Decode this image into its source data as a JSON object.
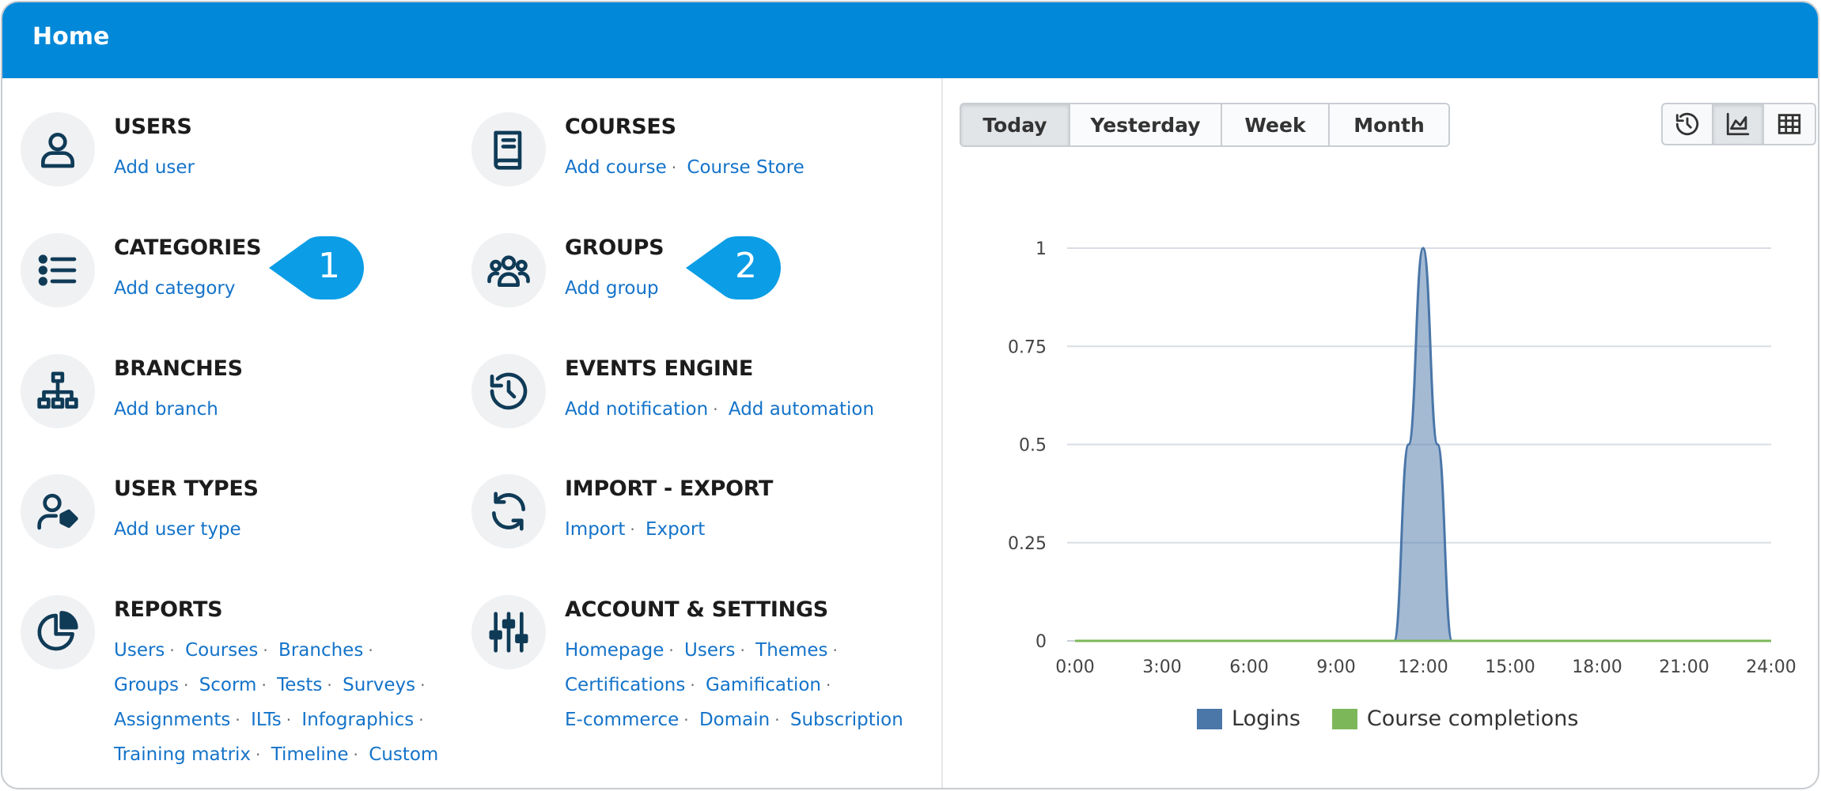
{
  "header": {
    "title": "Home"
  },
  "left_column": [
    {
      "key": "users",
      "title": "USERS",
      "icon": "user-icon",
      "links": [
        "Add user"
      ]
    },
    {
      "key": "categories",
      "title": "CATEGORIES",
      "icon": "list-icon",
      "links": [
        "Add category"
      ]
    },
    {
      "key": "branches",
      "title": "BRANCHES",
      "icon": "sitemap-icon",
      "links": [
        "Add branch"
      ]
    },
    {
      "key": "user-types",
      "title": "USER TYPES",
      "icon": "user-tag-icon",
      "links": [
        "Add user type"
      ]
    },
    {
      "key": "reports",
      "title": "REPORTS",
      "icon": "pie-chart-icon",
      "links": [
        "Users",
        "Courses",
        "Branches",
        "Groups",
        "Scorm",
        "Tests",
        "Surveys",
        "Assignments",
        "ILTs",
        "Infographics",
        "Training matrix",
        "Timeline",
        "Custom"
      ]
    }
  ],
  "right_column": [
    {
      "key": "courses",
      "title": "COURSES",
      "icon": "book-icon",
      "links": [
        "Add course",
        "Course Store"
      ]
    },
    {
      "key": "groups",
      "title": "GROUPS",
      "icon": "users-group-icon",
      "links": [
        "Add group"
      ]
    },
    {
      "key": "events-engine",
      "title": "EVENTS ENGINE",
      "icon": "history-icon",
      "links": [
        "Add notification",
        "Add automation"
      ]
    },
    {
      "key": "import-export",
      "title": "IMPORT - EXPORT",
      "icon": "sync-icon",
      "links": [
        "Import",
        "Export"
      ]
    },
    {
      "key": "account-settings",
      "title": "ACCOUNT & SETTINGS",
      "icon": "sliders-icon",
      "links": [
        "Homepage",
        "Users",
        "Themes",
        "Certifications",
        "Gamification",
        "E-commerce",
        "Domain",
        "Subscription"
      ]
    }
  ],
  "callouts": [
    "1",
    "2"
  ],
  "time_filters": [
    {
      "label": "Today",
      "active": true
    },
    {
      "label": "Yesterday",
      "active": false
    },
    {
      "label": "Week",
      "active": false
    },
    {
      "label": "Month",
      "active": false
    }
  ],
  "view_toggles": [
    {
      "icon": "history-icon",
      "active": false
    },
    {
      "icon": "area-chart-icon",
      "active": true
    },
    {
      "icon": "table-grid-icon",
      "active": false
    }
  ],
  "colors": {
    "header": "#0288d8",
    "link": "#1473c9",
    "callout": "#0b9de6",
    "logins": "#4a76a8",
    "completions": "#7cb85a"
  },
  "chart_data": {
    "type": "area",
    "x_ticks": [
      "0:00",
      "3:00",
      "6:00",
      "9:00",
      "12:00",
      "15:00",
      "18:00",
      "21:00",
      "24:00"
    ],
    "y_ticks": [
      "0",
      "0.25",
      "0.5",
      "0.75",
      "1"
    ],
    "xlim": [
      0,
      24
    ],
    "ylim": [
      0,
      1
    ],
    "series": [
      {
        "name": "Logins",
        "x": [
          0,
          11,
          11.5,
          12,
          12.5,
          13,
          24
        ],
        "y": [
          0,
          0,
          0.5,
          1,
          0.5,
          0,
          0
        ]
      },
      {
        "name": "Course completions",
        "x": [
          0,
          11,
          12,
          13,
          24
        ],
        "y": [
          0,
          0,
          0,
          0,
          0
        ]
      }
    ],
    "legend": [
      "Logins",
      "Course completions"
    ],
    "legend_position": "bottom"
  }
}
